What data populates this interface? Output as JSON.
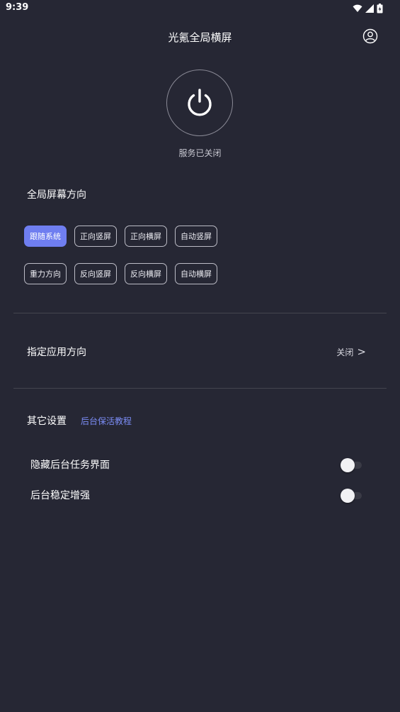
{
  "status_bar": {
    "time": "9:39"
  },
  "header": {
    "title": "光氪全局横屏",
    "account_icon": "account-circle-icon"
  },
  "power": {
    "icon": "power-icon",
    "status": "服务已关闭"
  },
  "global_orientation": {
    "title": "全局屏幕方向",
    "options_row1": [
      "跟随系统",
      "正向竖屏",
      "正向横屏",
      "自动竖屏"
    ],
    "options_row2": [
      "重力方向",
      "反向竖屏",
      "反向横屏",
      "自动横屏"
    ],
    "selected": "跟随系统"
  },
  "app_orientation": {
    "label": "指定应用方向",
    "value": "关闭",
    "chevron": ">"
  },
  "other_settings": {
    "title": "其它设置",
    "tutorial_link": "后台保活教程",
    "toggles": [
      {
        "label": "隐藏后台任务界面",
        "on": false
      },
      {
        "label": "后台稳定增强",
        "on": false
      }
    ]
  },
  "colors": {
    "background": "#262734",
    "accent": "#6f7ef0",
    "link": "#7b8cf5"
  }
}
